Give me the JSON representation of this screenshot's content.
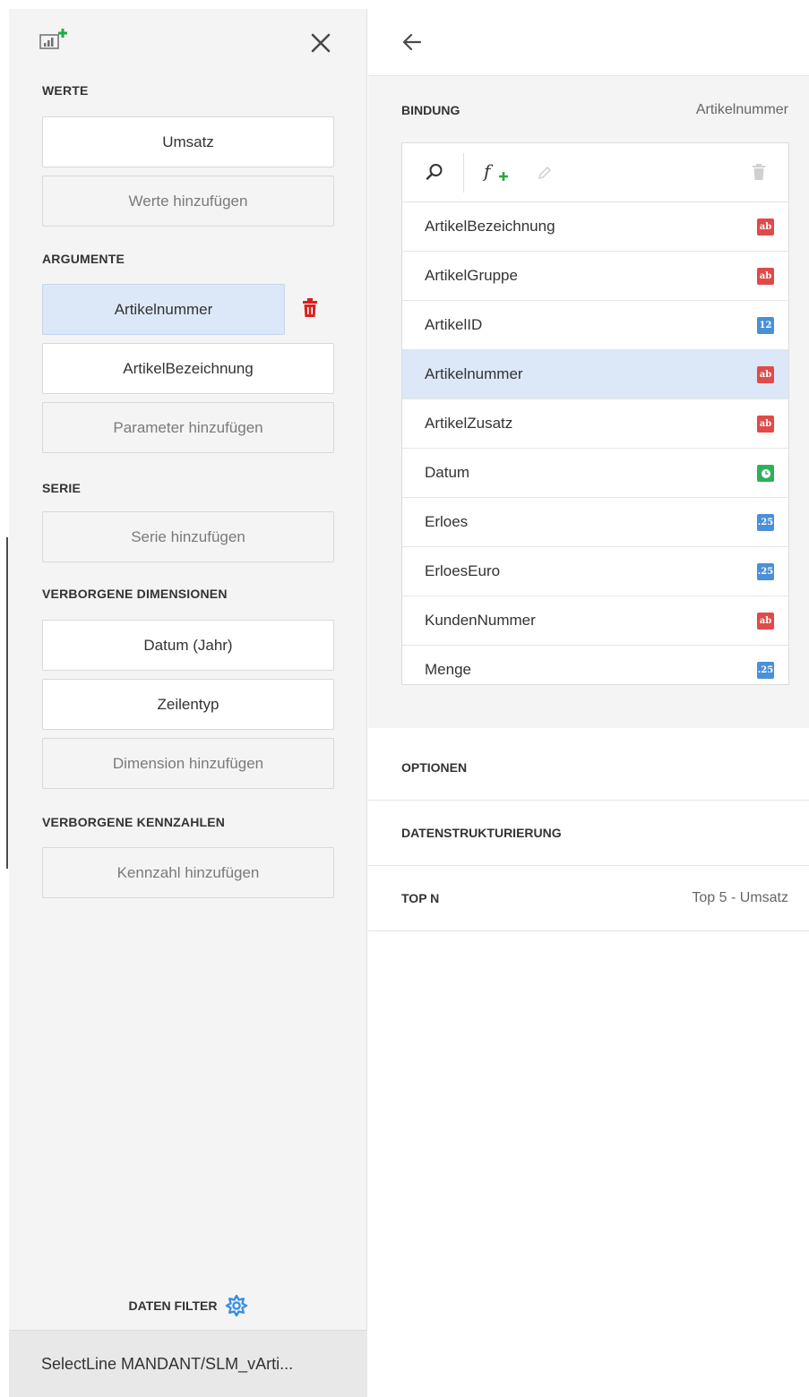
{
  "left_panel": {
    "sections": {
      "werte": {
        "title": "WERTE",
        "items": [
          "Umsatz"
        ],
        "add_label": "Werte hinzufügen"
      },
      "argumente": {
        "title": "ARGUMENTE",
        "items": [
          "Artikelnummer",
          "ArtikelBezeichnung"
        ],
        "add_label": "Parameter hinzufügen"
      },
      "serie": {
        "title": "SERIE",
        "add_label": "Serie hinzufügen"
      },
      "verborgene_dimensionen": {
        "title": "VERBORGENE DIMENSIONEN",
        "items": [
          "Datum (Jahr)",
          "Zeilentyp"
        ],
        "add_label": "Dimension hinzufügen"
      },
      "verborgene_kennzahlen": {
        "title": "VERBORGENE KENNZAHLEN",
        "add_label": "Kennzahl hinzufügen"
      }
    },
    "filter_label": "DATEN FILTER",
    "datasource": "SelectLine MANDANT/SLM_vArti..."
  },
  "right_panel": {
    "binding": {
      "title": "BINDUNG",
      "value": "Artikelnummer",
      "fields": [
        {
          "name": "ArtikelBezeichnung",
          "type": "ab"
        },
        {
          "name": "ArtikelGruppe",
          "type": "ab"
        },
        {
          "name": "ArtikelID",
          "type": "12"
        },
        {
          "name": "Artikelnummer",
          "type": "ab"
        },
        {
          "name": "ArtikelZusatz",
          "type": "ab"
        },
        {
          "name": "Datum",
          "type": "date"
        },
        {
          "name": "Erloes",
          "type": ".25"
        },
        {
          "name": "ErloesEuro",
          "type": ".25"
        },
        {
          "name": "KundenNummer",
          "type": "ab"
        },
        {
          "name": "Menge",
          "type": ".25"
        }
      ],
      "selected_field": "Artikelnummer"
    },
    "sections": [
      {
        "label": "OPTIONEN",
        "value": ""
      },
      {
        "label": "DATENSTRUKTURIERUNG",
        "value": ""
      },
      {
        "label": "TOP N",
        "value": "Top 5 - Umsatz"
      }
    ]
  },
  "colors": {
    "text_badge": "#e04a4a",
    "number_badge": "#4a90d9",
    "date_badge": "#2eb05a",
    "selection": "#dce8f8",
    "accent": "#4a90d9"
  }
}
